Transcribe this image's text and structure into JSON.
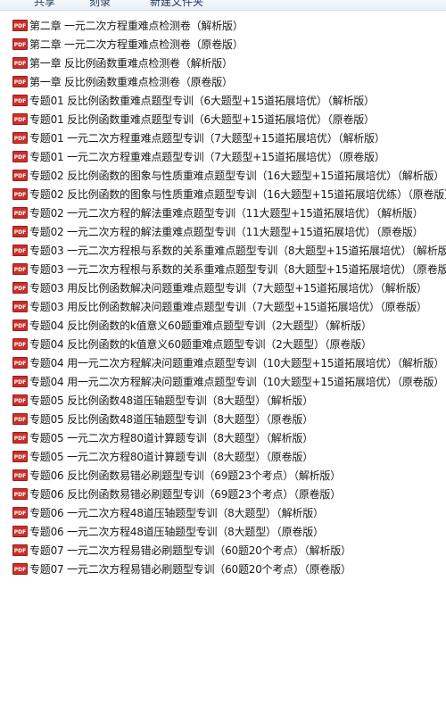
{
  "toolbar": {
    "items": [
      "共享",
      "刻录",
      "新建文件夹"
    ]
  },
  "icon": {
    "pdf_label": "PDF",
    "pdf_color": "#c9302c"
  },
  "files": [
    "第二章 一元二次方程重难点检测卷（解析版）",
    "第二章 一元二次方程重难点检测卷（原卷版）",
    "第一章 反比例函数重难点检测卷（解析版）",
    "第一章 反比例函数重难点检测卷（原卷版）",
    "专题01 反比例函数重难点题型专训（6大题型+15道拓展培优）（解析版）",
    "专题01 反比例函数重难点题型专训（6大题型+15道拓展培优）（原卷版）",
    "专题01 一元二次方程重难点题型专训（7大题型+15道拓展培优）（解析版）",
    "专题01 一元二次方程重难点题型专训（7大题型+15道拓展培优）（原卷版）",
    "专题02 反比例函数的图象与性质重难点题型专训（16大题型+15道拓展培优）（解析版）",
    "专题02 反比例函数的图象与性质重难点题型专训（16大题型+15道拓展培优练）（原卷版）",
    "专题02 一元二次方程的解法重难点题型专训（11大题型+15道拓展培优）（解析版）",
    "专题02 一元二次方程的解法重难点题型专训（11大题型+15道拓展培优）（原卷版）",
    "专题03 一元二次方程根与系数的关系重难点题型专训（8大题型+15道拓展培优）（解析版）",
    "专题03 一元二次方程根与系数的关系重难点题型专训（8大题型+15道拓展培优）（原卷版）",
    "专题03 用反比例函数解决问题重难点题型专训（7大题型+15道拓展培优）（解析版）",
    "专题03 用反比例函数解决问题重难点题型专训（7大题型+15道拓展培优）（原卷版）",
    "专题04 反比例函数的k值意义60题重难点题型专训（2大题型）（解析版）",
    "专题04 反比例函数的k值意义60题重难点题型专训（2大题型）（原卷版）",
    "专题04 用一元二次方程解决问题重难点题型专训（10大题型+15道拓展培优）（解析版）",
    "专题04 用一元二次方程解决问题重难点题型专训（10大题型+15道拓展培优）（原卷版）",
    "专题05 反比例函数48道压轴题型专训（8大题型）（解析版）",
    "专题05 反比例函数48道压轴题型专训（8大题型）（原卷版）",
    "专题05 一元二次方程80道计算题专训（8大题型）（解析版）",
    "专题05 一元二次方程80道计算题专训（8大题型）（原卷版）",
    "专题06 反比例函数易错必刷题型专训（69题23个考点）（解析版）",
    "专题06 反比例函数易错必刷题型专训（69题23个考点）（原卷版）",
    "专题06 一元二次方程48道压轴题型专训（8大题型）（解析版）",
    "专题06 一元二次方程48道压轴题型专训（8大题型）（原卷版）",
    "专题07 一元二次方程易错必刷题型专训（60题20个考点）（解析版）",
    "专题07 一元二次方程易错必刷题型专训（60题20个考点）（原卷版）"
  ]
}
